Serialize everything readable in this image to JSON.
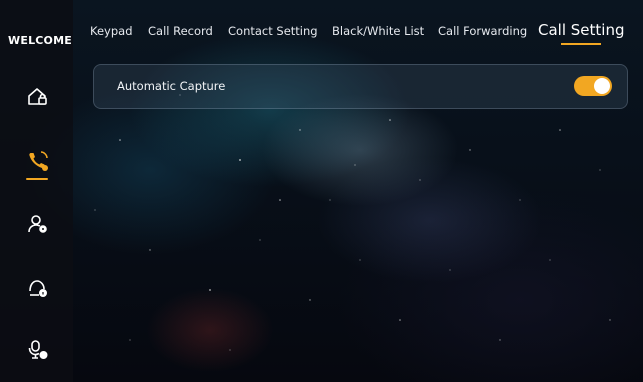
{
  "sidebar": {
    "title": "WELCOME",
    "items": [
      {
        "icon": "home-lock-icon",
        "active": false
      },
      {
        "icon": "phone-call-icon",
        "active": true
      },
      {
        "icon": "user-settings-icon",
        "active": false
      },
      {
        "icon": "user-info-icon",
        "active": false
      },
      {
        "icon": "microphone-user-icon",
        "active": false
      }
    ]
  },
  "tabs": [
    {
      "label": "Keypad"
    },
    {
      "label": "Call Record"
    },
    {
      "label": "Contact Setting"
    },
    {
      "label": "Black/White List"
    },
    {
      "label": "Call Forwarding"
    },
    {
      "label": "Call Setting",
      "active": true
    }
  ],
  "settings": {
    "automatic_capture": {
      "label": "Automatic Capture",
      "enabled": true
    }
  },
  "colors": {
    "accent": "#f2a722",
    "sidebar_bg": "#0c0e14",
    "text": "#ffffff"
  }
}
